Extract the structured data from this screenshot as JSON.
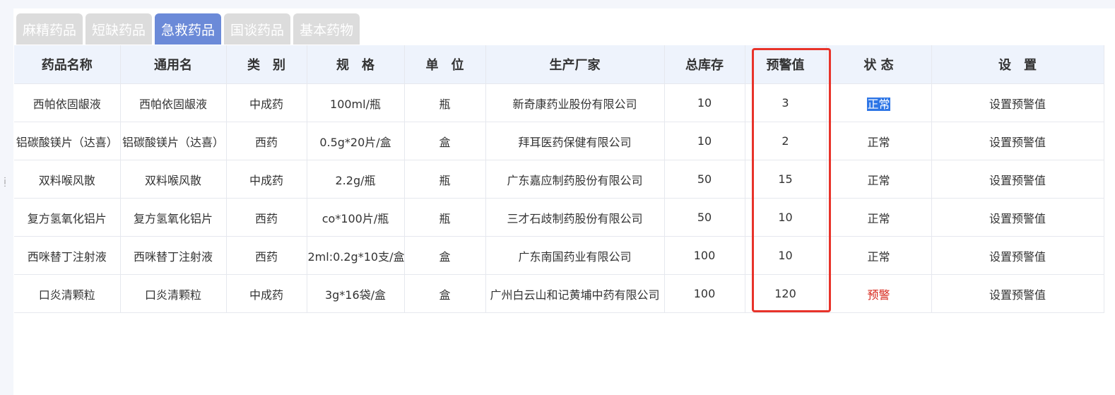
{
  "tabs": [
    {
      "label": "麻精药品"
    },
    {
      "label": "短缺药品"
    },
    {
      "label": "急救药品"
    },
    {
      "label": "国谈药品"
    },
    {
      "label": "基本药物"
    }
  ],
  "table": {
    "headers": [
      "药品名称",
      "通用名",
      "类　别",
      "规　格",
      "单　位",
      "生产厂家",
      "总库存",
      "预警值",
      "状 态",
      "设　置"
    ],
    "rows": [
      [
        "西帕依固龈液",
        "西帕依固龈液",
        "中成药",
        "100ml/瓶",
        "瓶",
        "新奇康药业股份有限公司",
        "10",
        "3",
        "正常",
        "设置预警值"
      ],
      [
        "铝碳酸镁片（达喜）",
        "铝碳酸镁片（达喜）",
        "西药",
        "0.5g*20片/盒",
        "盒",
        "拜耳医药保健有限公司",
        "10",
        "2",
        "正常",
        "设置预警值"
      ],
      [
        "双料喉风散",
        "双料喉风散",
        "中成药",
        "2.2g/瓶",
        "瓶",
        "广东嘉应制药股份有限公司",
        "50",
        "15",
        "正常",
        "设置预警值"
      ],
      [
        "复方氢氧化铝片",
        "复方氢氧化铝片",
        "西药",
        "co*100片/瓶",
        "瓶",
        "三才石歧制药股份有限公司",
        "50",
        "10",
        "正常",
        "设置预警值"
      ],
      [
        "西咪替丁注射液",
        "西咪替丁注射液",
        "西药",
        "2ml:0.2g*10支/盒",
        "盒",
        "广东南国药业有限公司",
        "100",
        "10",
        "正常",
        "设置预警值"
      ],
      [
        "口炎清颗粒",
        "口炎清颗粒",
        "中成药",
        "3g*16袋/盒",
        "盒",
        "广州白云山和记黄埔中药有限公司",
        "100",
        "120",
        "预警",
        "设置预警值"
      ]
    ]
  },
  "colors": {
    "active_tab": "#6b8ad8",
    "inactive_tab": "#dcdcdc",
    "header_bg": "#eef3fc",
    "warning_text": "#d7261a",
    "highlight_border": "#e8332a"
  }
}
